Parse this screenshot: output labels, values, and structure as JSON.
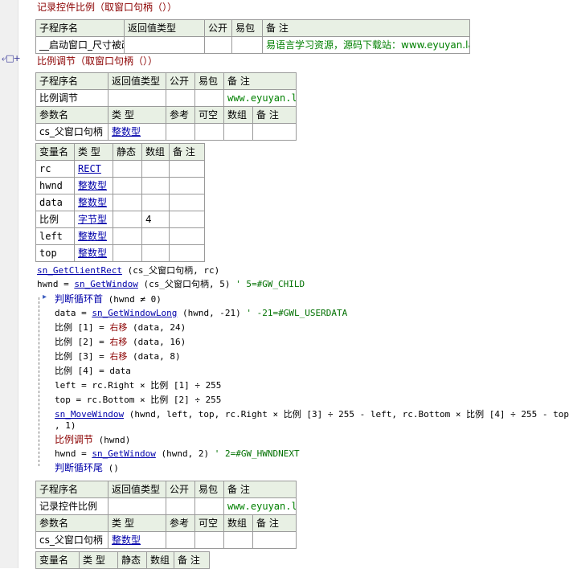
{
  "sub1": {
    "title": "记录控件比例（取窗口句柄（））",
    "header": [
      "子程序名",
      "返回值类型",
      "公开",
      "易包",
      "备 注"
    ],
    "row": [
      "__启动窗口_尺寸被改变",
      "",
      "",
      "",
      "易语言学习资源，源码下载站：www.eyuyan.la"
    ]
  },
  "sub2": {
    "title": "比例调节（取窗口句柄（））",
    "header": [
      "子程序名",
      "返回值类型",
      "公开",
      "易包",
      "备 注"
    ],
    "row": [
      "比例调节",
      "",
      "",
      "",
      "www.eyuyan.la"
    ],
    "param_header": [
      "参数名",
      "类 型",
      "参考",
      "可空",
      "数组",
      "备 注"
    ],
    "param_row": [
      "cs_父窗口句柄",
      "整数型",
      "",
      "",
      "",
      ""
    ],
    "var_header": [
      "变量名",
      "类 型",
      "静态",
      "数组",
      "备 注"
    ],
    "vars": [
      [
        "rc",
        "RECT",
        "",
        "",
        ""
      ],
      [
        "hwnd",
        "整数型",
        "",
        "",
        ""
      ],
      [
        "data",
        "整数型",
        "",
        "",
        ""
      ],
      [
        "比例",
        "字节型",
        "",
        "4",
        ""
      ],
      [
        "left",
        "整数型",
        "",
        "",
        ""
      ],
      [
        "top",
        "整数型",
        "",
        "",
        ""
      ]
    ]
  },
  "code": {
    "l1_fn": "sn_GetClientRect",
    "l1_args": " (cs_父窗口句柄, rc)",
    "l2_a": "hwnd = ",
    "l2_fn": "sn_GetWindow",
    "l2_b": " (cs_父窗口句柄, 5)",
    "l2_cmt": " ' 5=#GW_CHILD",
    "l3_kw": "判断循环首",
    "l3_b": " (hwnd ≠ 0)",
    "l4_a": "data = ",
    "l4_fn": "sn_GetWindowLong",
    "l4_b": " (hwnd, -21)",
    "l4_cmt": " ' -21=#GWL_USERDATA",
    "l5_a": "比例 [1] = ",
    "l5_kw": "右移",
    "l5_b": " (data, 24)",
    "l6_a": "比例 [2] = ",
    "l6_kw": "右移",
    "l6_b": " (data, 16)",
    "l7_a": "比例 [3] = ",
    "l7_kw": "右移",
    "l7_b": " (data, 8)",
    "l8": "比例 [4] = data",
    "l9": "left = rc.Right × 比例 [1] ÷ 255",
    "l10": "top = rc.Bottom × 比例 [2] ÷ 255",
    "l11_fn": "sn_MoveWindow",
    "l11_b": " (hwnd, left, top, rc.Right × 比例 [3] ÷ 255 - left, rc.Bottom × 比例 [4] ÷ 255 - top",
    "l11_c": ", 1)",
    "l12_fn": "比例调节",
    "l12_b": " (hwnd)",
    "l13_a": "hwnd = ",
    "l13_fn": "sn_GetWindow",
    "l13_b": " (hwnd, 2)",
    "l13_cmt": " ' 2=#GW_HWNDNEXT",
    "l14_kw": "判断循环尾",
    "l14_b": " ()"
  },
  "sub3": {
    "header": [
      "子程序名",
      "返回值类型",
      "公开",
      "易包",
      "备 注"
    ],
    "row": [
      "记录控件比例",
      "",
      "",
      "",
      "www.eyuyan.la"
    ],
    "param_header": [
      "参数名",
      "类 型",
      "参考",
      "可空",
      "数组",
      "备 注"
    ],
    "param_row": [
      "cs_父窗口句柄",
      "整数型",
      "",
      "",
      "",
      ""
    ],
    "var_header": [
      "变量名",
      "类 型",
      "静态",
      "数组",
      "备 注"
    ]
  },
  "gutter_icon": "breakpoint-plus-icon"
}
